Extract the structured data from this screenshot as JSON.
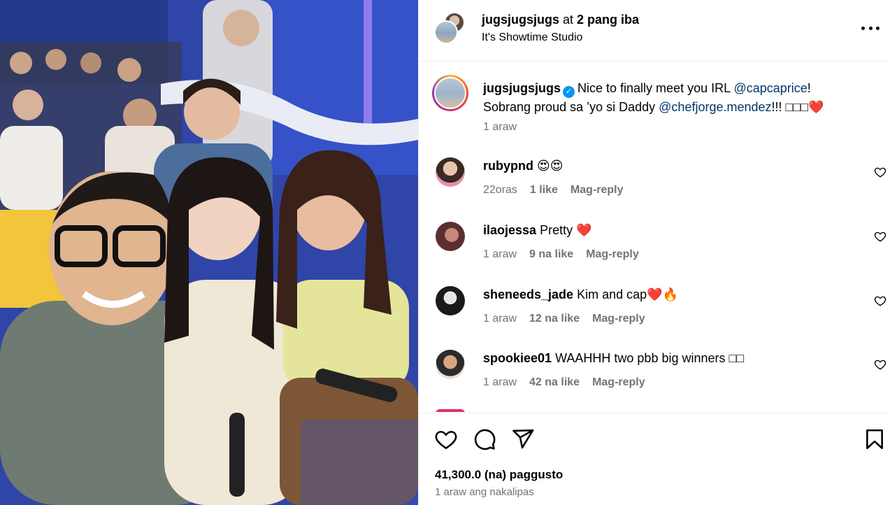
{
  "header": {
    "username": "jugsjugsjugs",
    "connector": " at ",
    "others": "2 pang iba",
    "location": "It's Showtime Studio"
  },
  "caption": {
    "username": "jugsjugsjugs",
    "text_1": "Nice to finally meet you IRL ",
    "mention_1": "@capcaprice",
    "text_2": "! Sobrang proud sa ’yo si Daddy ",
    "mention_2": "@chefjorge.mendez",
    "text_3": "!!! □□□",
    "emoji": "❤️",
    "time": "1 araw"
  },
  "comments": [
    {
      "username": "rubypnd",
      "text": "😍😍",
      "time": "22oras",
      "likes": "1 like",
      "reply": "Mag-reply"
    },
    {
      "username": "ilaojessa",
      "text": "Pretty ❤️",
      "time": "1 araw",
      "likes": "9 na like",
      "reply": "Mag-reply"
    },
    {
      "username": "sheneeds_jade",
      "text": "Kim and cap❤️🔥",
      "time": "1 araw",
      "likes": "12 na like",
      "reply": "Mag-reply"
    },
    {
      "username": "spookiee01",
      "text": "WAAHHH two pbb big winners □□",
      "time": "1 araw",
      "likes": "42 na like",
      "reply": "Mag-reply"
    }
  ],
  "footer": {
    "likes": "41,300.0 (na) paggusto",
    "posted": "1 araw ang nakalipas"
  },
  "colors": {
    "link": "#00376b",
    "muted": "#737373",
    "verified": "#0095f6",
    "heart": "#e0242f"
  },
  "icons": [
    "more-icon",
    "verified-icon",
    "heart-icon",
    "comment-icon",
    "share-icon",
    "bookmark-icon"
  ]
}
